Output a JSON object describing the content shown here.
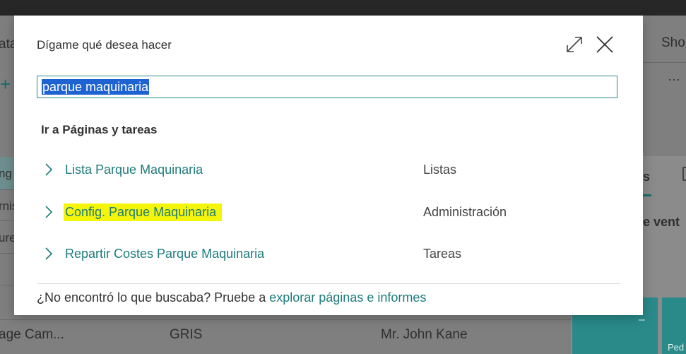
{
  "background": {
    "left_fragments": [
      "ata",
      "ng",
      "rnis",
      "ure"
    ],
    "right_fragments": [
      "Sho",
      "s",
      "e vent",
      "Ped"
    ],
    "row": {
      "col1": "age Cam...",
      "col2": "GRIS",
      "col3": "Mr. John Kane"
    },
    "minus": "–",
    "ellipsis": "···",
    "plus": "+"
  },
  "dialog": {
    "title": "Dígame qué desea hacer",
    "search": {
      "value": "parque maquinaria"
    },
    "section_title": "Ir a Páginas y tareas",
    "results": [
      {
        "label": "Lista Parque Maquinaria",
        "category": "Listas",
        "highlighted": false
      },
      {
        "label": "Config. Parque Maquinaria",
        "category": "Administración",
        "highlighted": true
      },
      {
        "label": "Repartir Costes Parque Maquinaria",
        "category": "Tareas",
        "highlighted": false
      }
    ],
    "footer": {
      "text": "¿No encontró lo que buscaba? Pruebe a ",
      "link": "explorar páginas e informes"
    },
    "icons": {
      "expand": "expand-icon",
      "close": "close-icon",
      "chevron": "chevron-right-icon"
    },
    "colors": {
      "accent": "#1d7b7b",
      "highlight": "#f5f50a",
      "selection": "#1e63d1"
    }
  }
}
